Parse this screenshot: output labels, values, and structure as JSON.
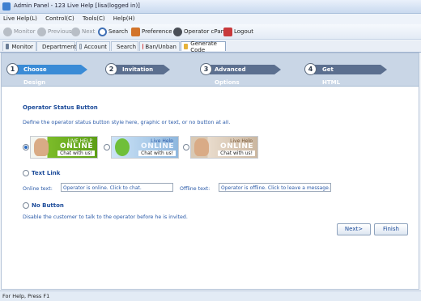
{
  "window": {
    "title": "Admin Panel - 123 Live Help [lisa(logged in)]"
  },
  "menu": [
    "Live Help(L)",
    "Control(C)",
    "Tools(C)",
    "Help(H)"
  ],
  "toolbar": {
    "monitor": "Monitor",
    "previous": "Previous",
    "next": "Next",
    "search": "Search",
    "preference": "Preference",
    "operator_cpanel": "Operator cPanel",
    "logout": "Logout"
  },
  "tabs": [
    "Monitor",
    "Department",
    "Account",
    "Search",
    "Ban/Unban",
    "Generate Code"
  ],
  "wizard": {
    "steps": [
      {
        "num": "1",
        "label": "Choose Design",
        "active": true
      },
      {
        "num": "2",
        "label": "Invitation",
        "active": false
      },
      {
        "num": "3",
        "label": "Advanced Options",
        "active": false
      },
      {
        "num": "4",
        "label": "Get HTML Code",
        "active": false
      }
    ]
  },
  "form": {
    "section_title": "Operator Status Button",
    "description": "Define the operator status button style here, graphic or text, or no button at all.",
    "banners": [
      {
        "line1": "LIVE HELP",
        "line2": "ONLINE",
        "chat": "Chat with us!",
        "selected": true
      },
      {
        "line1": "Live Help",
        "line2": "ONLINE",
        "chat": "Chat with us!",
        "selected": false
      },
      {
        "line1": "Live Help",
        "line2": "ONLINE",
        "chat": "Chat with us!",
        "selected": false
      }
    ],
    "text_link_label": "Text Link",
    "online_text_label": "Online text:",
    "online_text_value": "Operator is online. Click to chat.",
    "offline_text_label": "Offline text:",
    "offline_text_value": "Operator is offline. Click to leave a message.",
    "no_button_label": "No Button",
    "no_button_desc": "Disable the customer to talk to the operator before he is invited."
  },
  "buttons": {
    "next": "Next>",
    "finish": "Finish"
  },
  "status": {
    "text": "For Help, Press F1"
  },
  "colors": {
    "accent": "#1d4c9a",
    "wizard_active": "#3a8bd6",
    "wizard_inactive": "#5b6f8f"
  }
}
